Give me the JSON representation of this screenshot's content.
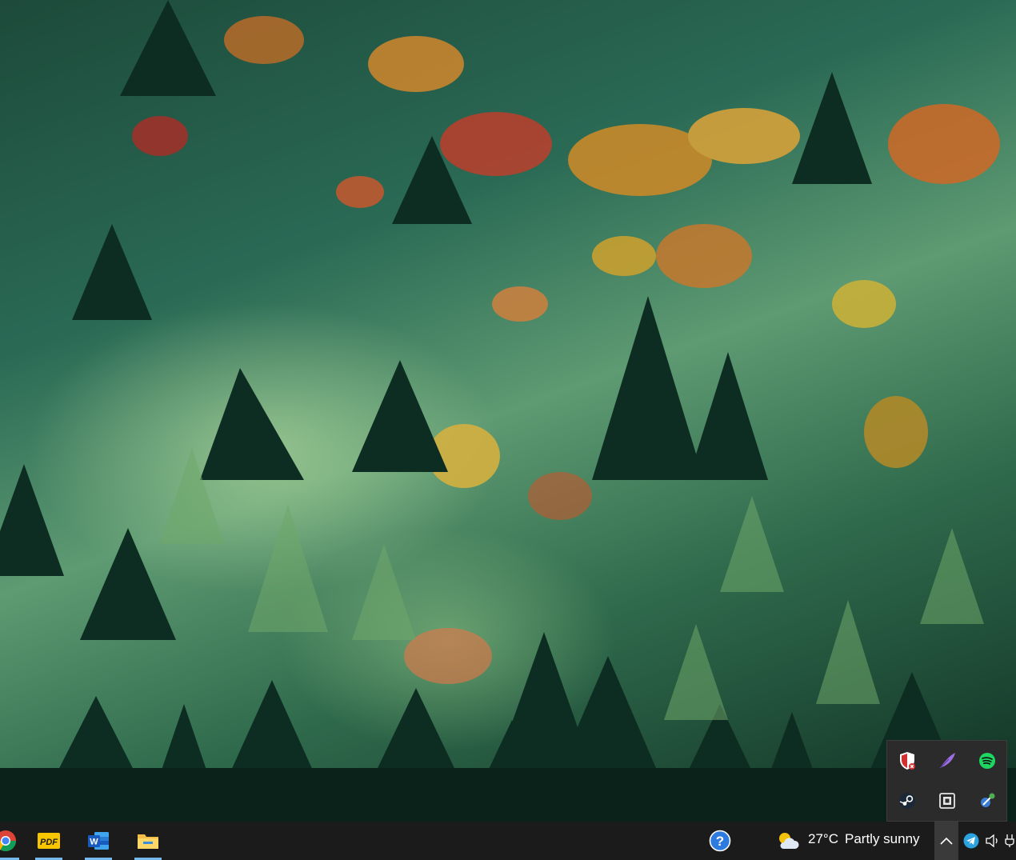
{
  "taskbar": {
    "apps": [
      {
        "name": "chrome-taskbar-icon"
      },
      {
        "name": "pdf-app-taskbar-icon",
        "label": "PDF"
      },
      {
        "name": "word-taskbar-icon",
        "label": "W"
      },
      {
        "name": "file-explorer-taskbar-icon"
      }
    ],
    "weather": {
      "temperature": "27°C",
      "condition": "Partly sunny",
      "icon": "partly-sunny-icon"
    },
    "help_icon": "help-icon",
    "show_hidden_icons": "chevron-up-icon",
    "tray": [
      "telegram-icon",
      "volume-icon",
      "network-icon"
    ]
  },
  "tray_flyout": {
    "icons": [
      "security-shield-icon",
      "feather-app-icon",
      "spotify-icon",
      "steam-icon",
      "gpu-settings-icon",
      "satellite-app-icon"
    ]
  },
  "colors": {
    "taskbar": "#1b1b1b",
    "flyout": "#2b2b2b",
    "accent": "#76b9ed",
    "spotify": "#1ed760"
  }
}
